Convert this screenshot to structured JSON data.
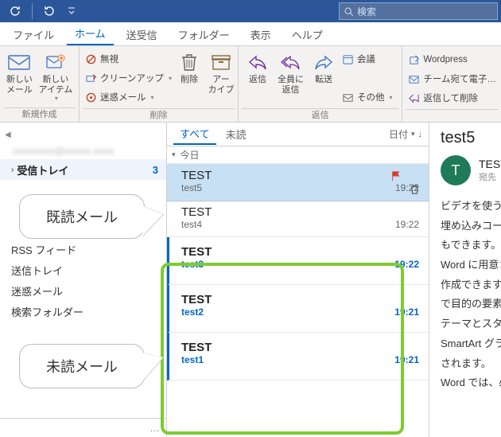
{
  "colors": {
    "accent": "#2b579a",
    "blue": "#0066c0",
    "green": "#7ecb31"
  },
  "titlebar": {
    "refresh_icon": "refresh",
    "undo_icon": "undo",
    "dropdown_icon": "chevron-down",
    "search_placeholder": "検索"
  },
  "tabs": [
    {
      "id": "file",
      "label": "ファイル"
    },
    {
      "id": "home",
      "label": "ホーム",
      "active": true
    },
    {
      "id": "sendrecv",
      "label": "送受信"
    },
    {
      "id": "folder",
      "label": "フォルダー"
    },
    {
      "id": "view",
      "label": "表示"
    },
    {
      "id": "help",
      "label": "ヘルプ"
    }
  ],
  "ribbon": {
    "new_group": {
      "label": "新規作成",
      "new_mail": "新しい\nメール",
      "new_item": "新しい\nアイテム"
    },
    "delete_group": {
      "label": "削除",
      "ignore": "無視",
      "cleanup": "クリーンアップ",
      "junk": "迷惑メール",
      "delete": "削除",
      "archive": "アー\nカイブ"
    },
    "reply_group": {
      "label": "返信",
      "reply": "返信",
      "reply_all": "全員に\n返信",
      "forward": "転送",
      "meeting": "会議",
      "other": "その他"
    },
    "quick_group": {
      "wordpress": "Wordpress",
      "team": "チーム宛て電子…",
      "reply_del": "返信して削除"
    }
  },
  "nav": {
    "account_blurred": "xxxxxxxx@xxxxx.xxxx",
    "inbox": {
      "label": "受信トレイ",
      "count": "3"
    },
    "rss": "RSS フィード",
    "outbox": "送信トレイ",
    "junk": "迷惑メール",
    "search": "検索フォルダー",
    "more": "…"
  },
  "filter": {
    "all": "すべて",
    "unread": "未読",
    "sort": "日付"
  },
  "group_header": "今日",
  "messages": [
    {
      "from": "TEST",
      "subject": "test5",
      "time": "19:22",
      "state": "selected"
    },
    {
      "from": "TEST",
      "subject": "test4",
      "time": "19:22",
      "state": "read"
    },
    {
      "from": "TEST",
      "subject": "test3",
      "time": "19:22",
      "state": "unread"
    },
    {
      "from": "TEST",
      "subject": "test2",
      "time": "19:21",
      "state": "unread"
    },
    {
      "from": "TEST",
      "subject": "test1",
      "time": "19:21",
      "state": "unread"
    }
  ],
  "reading": {
    "title": "test5",
    "avatar_letter": "T",
    "sender_name": "TEST",
    "to_line": "宛先",
    "body_lines": [
      "ビデオを使うと",
      "埋め込みコー",
      "もできます。",
      "Word に用意さ",
      "作成できます。",
      "で目的の要素を",
      "テーマとスタ",
      "SmartArt グラ",
      "されます。",
      "Word では、必"
    ]
  },
  "callouts": {
    "read": "既読メール",
    "unread": "未読メール"
  }
}
